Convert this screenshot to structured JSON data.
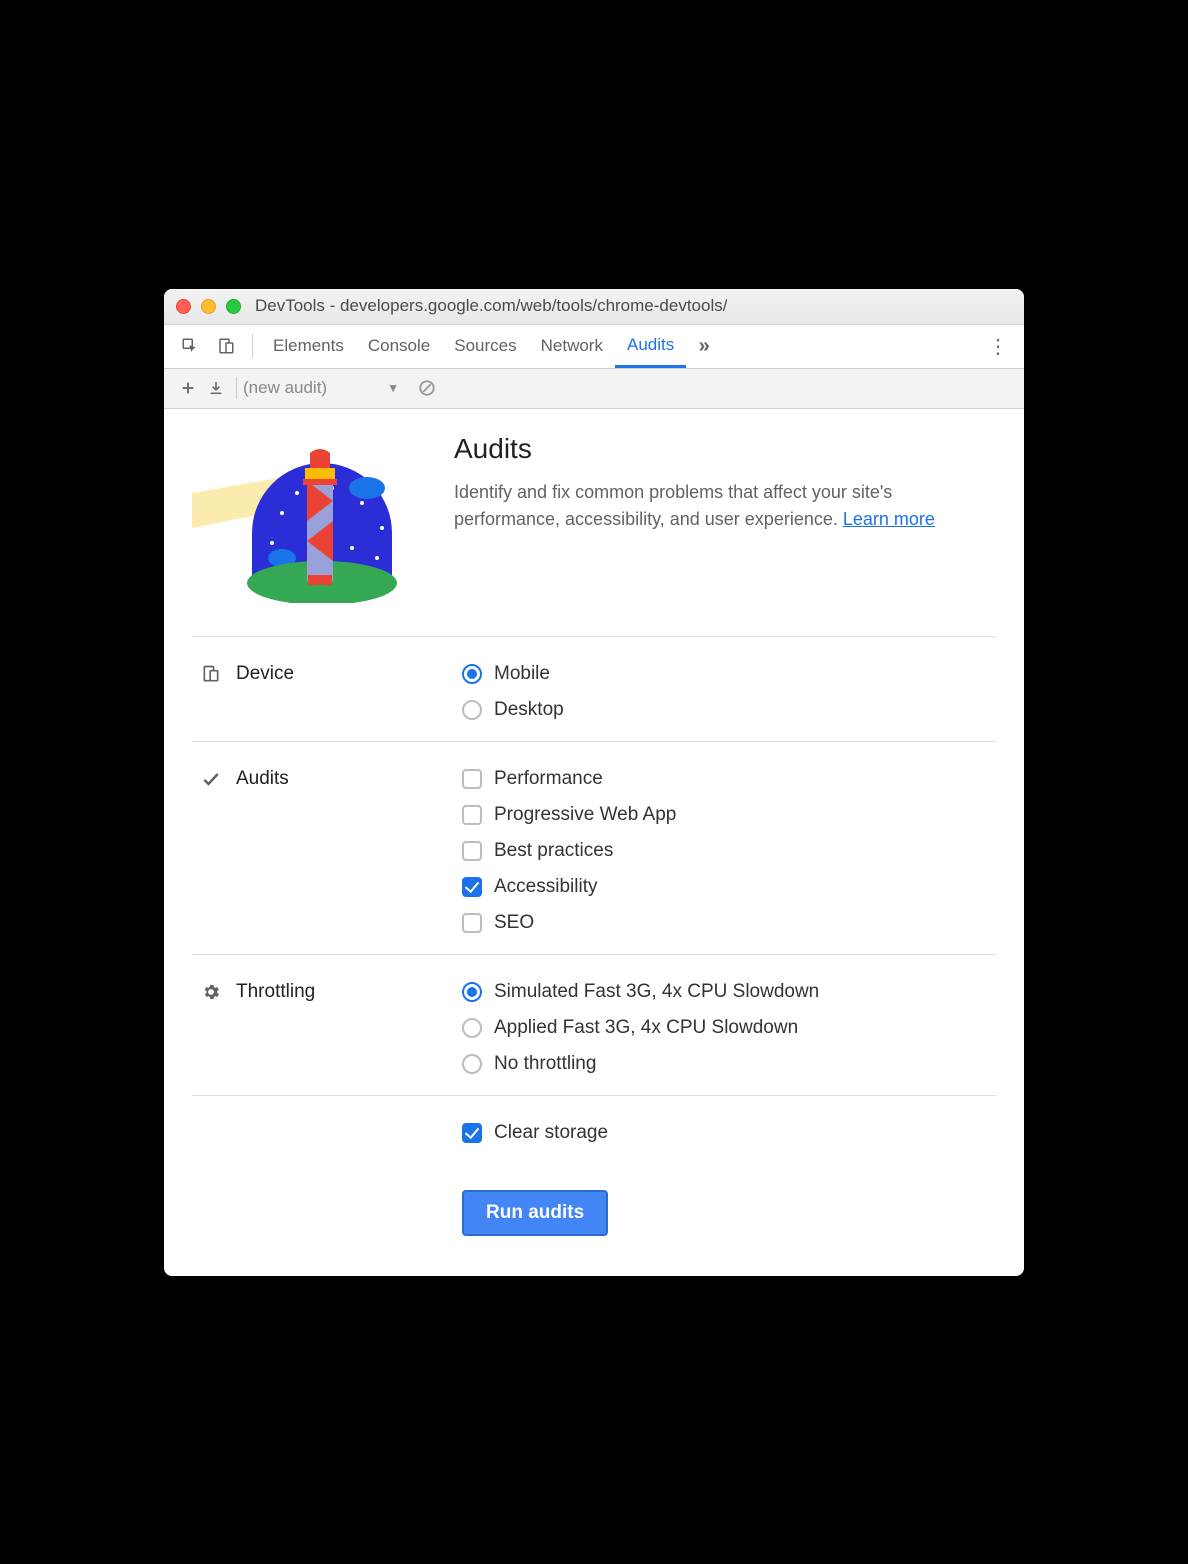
{
  "window": {
    "title": "DevTools - developers.google.com/web/tools/chrome-devtools/"
  },
  "tabs": {
    "elements": "Elements",
    "console": "Console",
    "sources": "Sources",
    "network": "Network",
    "audits": "Audits"
  },
  "secondbar": {
    "audit_select": "(new audit)"
  },
  "intro": {
    "heading": "Audits",
    "body": "Identify and fix common problems that affect your site's performance, accessibility, and user experience. ",
    "learn_more": "Learn more"
  },
  "sections": {
    "device": {
      "label": "Device",
      "options": {
        "mobile": "Mobile",
        "desktop": "Desktop"
      }
    },
    "audits": {
      "label": "Audits",
      "options": {
        "performance": "Performance",
        "pwa": "Progressive Web App",
        "best_practices": "Best practices",
        "accessibility": "Accessibility",
        "seo": "SEO"
      }
    },
    "throttling": {
      "label": "Throttling",
      "options": {
        "simulated": "Simulated Fast 3G, 4x CPU Slowdown",
        "applied": "Applied Fast 3G, 4x CPU Slowdown",
        "none": "No throttling"
      }
    },
    "clear_storage": "Clear storage"
  },
  "run_button": "Run audits"
}
